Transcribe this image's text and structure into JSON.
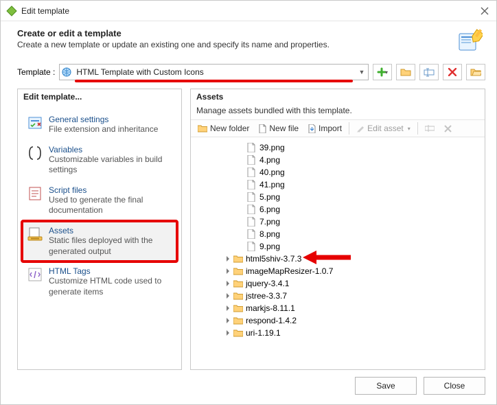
{
  "window": {
    "title": "Edit template"
  },
  "header": {
    "title": "Create or edit a template",
    "desc": "Create a new template or update an existing one and specify its name and properties."
  },
  "templateRow": {
    "label": "Template :",
    "value": "HTML Template with Custom Icons"
  },
  "left": {
    "title": "Edit template...",
    "items": [
      {
        "title": "General settings",
        "desc": "File extension and inheritance"
      },
      {
        "title": "Variables",
        "desc": "Customizable variables in build settings"
      },
      {
        "title": "Script files",
        "desc": "Used to generate the final documentation"
      },
      {
        "title": "Assets",
        "desc": "Static files deployed with the generated output"
      },
      {
        "title": "HTML Tags",
        "desc": "Customize HTML code used to generate items"
      }
    ],
    "selected": 3
  },
  "right": {
    "title": "Assets",
    "desc": "Manage assets bundled with this template.",
    "toolbar": {
      "newfolder": "New folder",
      "newfile": "New file",
      "import": "Import",
      "edit": "Edit asset"
    },
    "files": [
      "39.png",
      "4.png",
      "40.png",
      "41.png",
      "5.png",
      "6.png",
      "7.png",
      "8.png",
      "9.png"
    ],
    "folders": [
      "html5shiv-3.7.3",
      "imageMapResizer-1.0.7",
      "jquery-3.4.1",
      "jstree-3.3.7",
      "markjs-8.11.1",
      "respond-1.4.2",
      "uri-1.19.1"
    ]
  },
  "footer": {
    "save": "Save",
    "close": "Close"
  }
}
